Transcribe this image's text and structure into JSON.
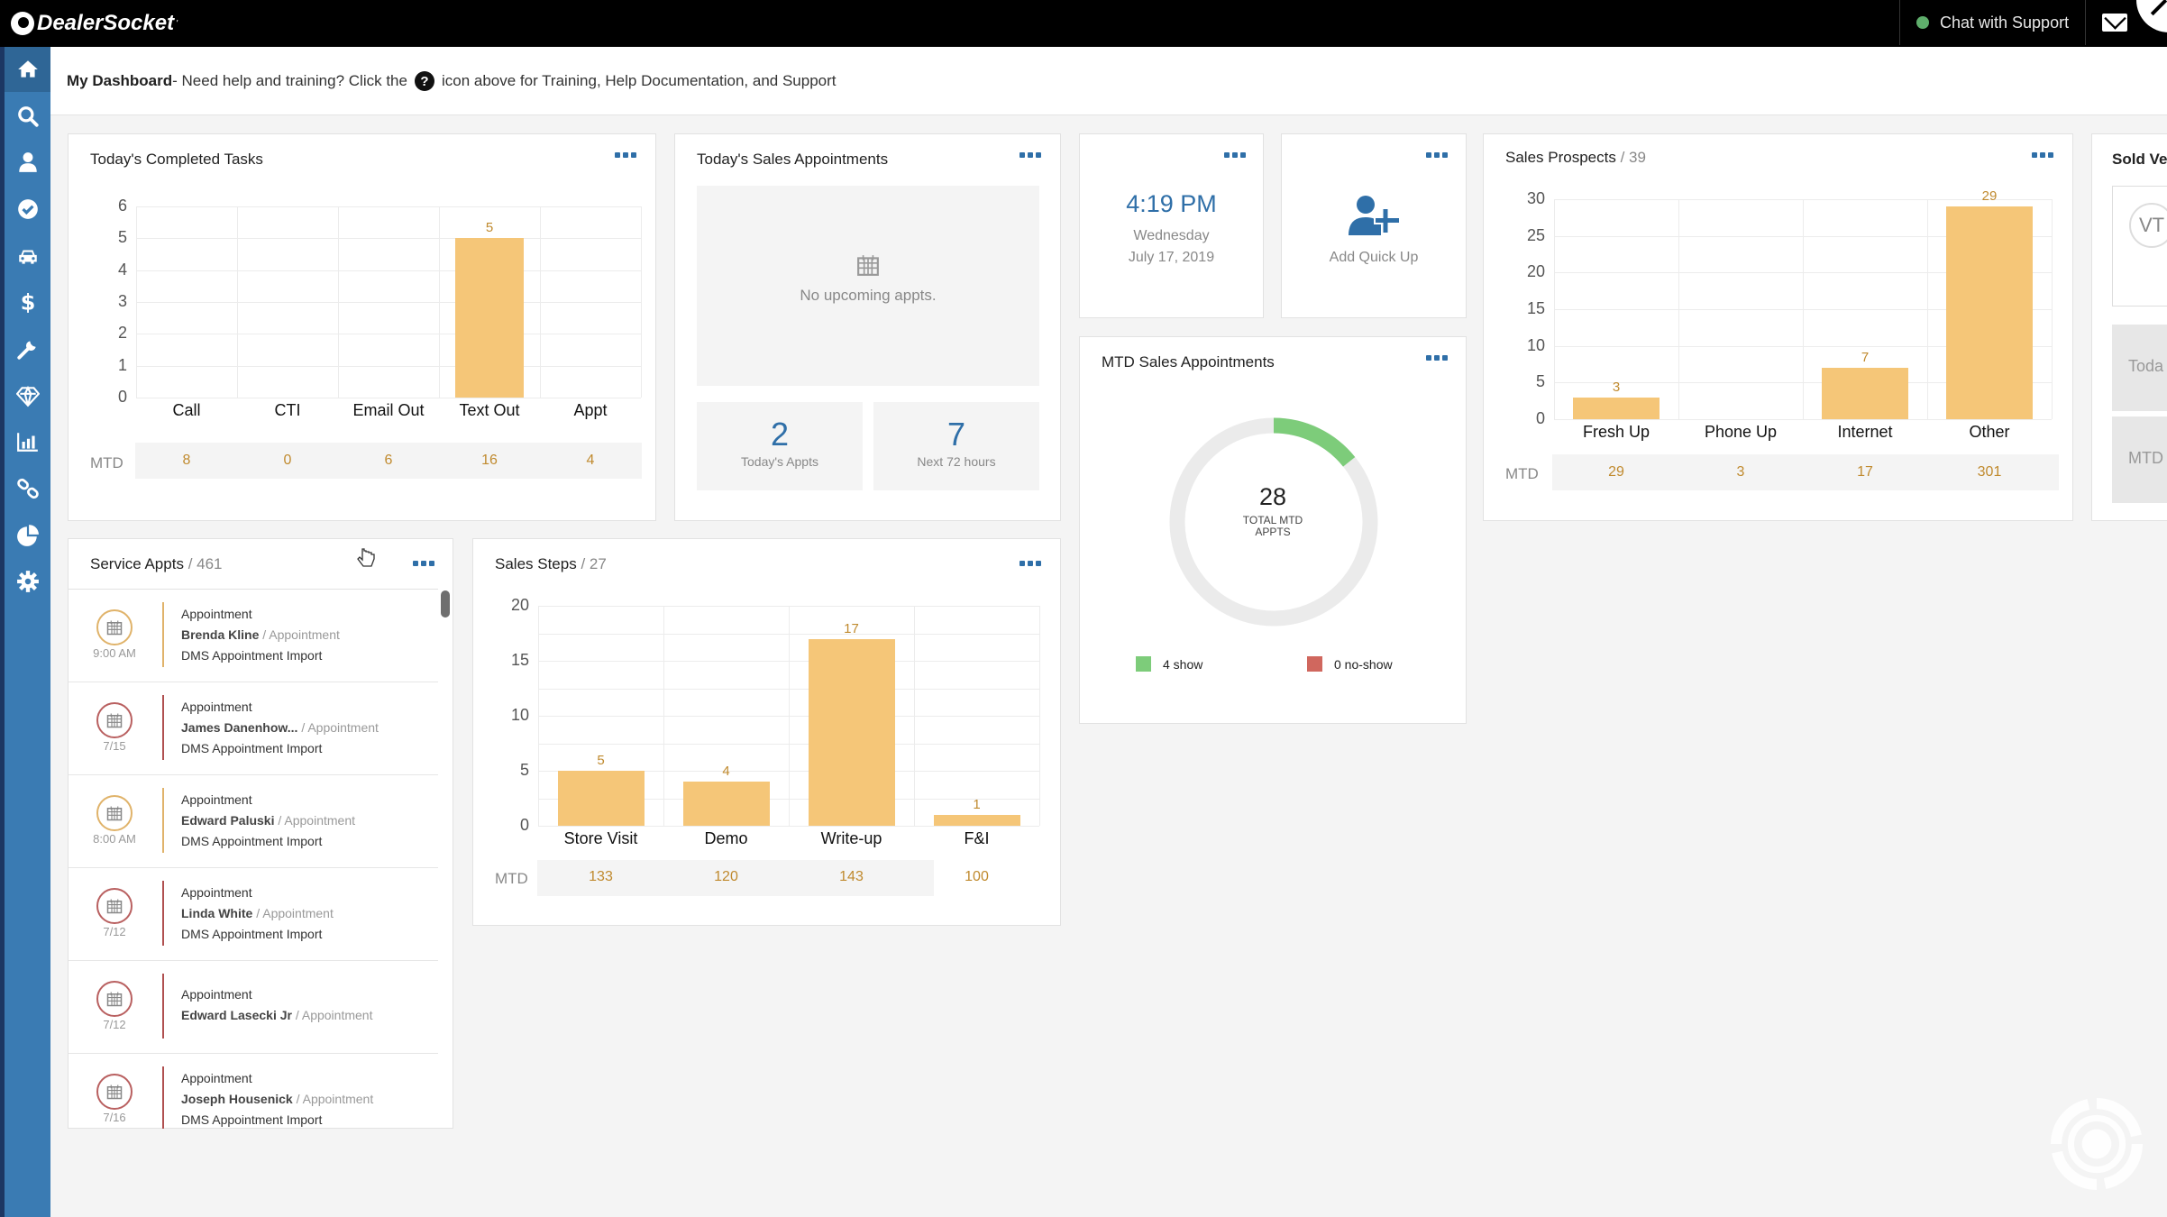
{
  "app": {
    "brand": "DealerSocket",
    "chat_label": "Chat with Support",
    "chat_status_color": "#5fae6c",
    "accent_color": "#2f6fa8",
    "bar_color": "#f5c678",
    "value_color": "#c08a2e"
  },
  "sidebar": {
    "items": [
      {
        "name": "home",
        "icon": "home-icon",
        "active": true
      },
      {
        "name": "search",
        "icon": "search-icon"
      },
      {
        "name": "contacts",
        "icon": "user-icon"
      },
      {
        "name": "tasks",
        "icon": "check-circle-icon"
      },
      {
        "name": "inventory",
        "icon": "car-icon"
      },
      {
        "name": "deals",
        "icon": "dollar-icon"
      },
      {
        "name": "service",
        "icon": "wrench-icon"
      },
      {
        "name": "loyalty",
        "icon": "diamond-icon"
      },
      {
        "name": "reports",
        "icon": "bar-chart-icon"
      },
      {
        "name": "links",
        "icon": "link-icon"
      },
      {
        "name": "analytics",
        "icon": "pie-chart-icon"
      },
      {
        "name": "settings",
        "icon": "gear-icon"
      }
    ]
  },
  "header": {
    "title": "My Dashboard",
    "help_before": " - Need help and training? Click the",
    "help_after": "icon above for Training, Help Documentation, and Support",
    "help_glyph": "?"
  },
  "completed_tasks": {
    "title": "Today's Completed Tasks",
    "mtd_label": "MTD",
    "mtd_values": [
      "8",
      "0",
      "6",
      "16",
      "4"
    ]
  },
  "sales_appointments": {
    "title": "Today's Sales Appointments",
    "empty_message": "No upcoming appts.",
    "today_count": "2",
    "today_label": "Today's Appts",
    "next_count": "7",
    "next_label": "Next 72 hours"
  },
  "clock": {
    "time": "4:19 PM",
    "day": "Wednesday",
    "date": "July 17, 2019"
  },
  "quick_up": {
    "label": "Add Quick Up"
  },
  "mtd_sales_appts": {
    "title": "MTD Sales Appointments",
    "total": "28",
    "total_label_1": "TOTAL MTD",
    "total_label_2": "APPTS",
    "show_label": "4 show",
    "noshow_label": "0 no-show",
    "show_color": "#7dcc7a",
    "noshow_color": "#d0675e",
    "track_color": "#ebebeb"
  },
  "sales_prospects": {
    "title": "Sales Prospects",
    "count": "/ 39",
    "mtd_label": "MTD",
    "mtd_values": [
      "29",
      "3",
      "17",
      "301"
    ]
  },
  "sold_vehicles": {
    "title": "Sold Ve",
    "avatar_initials": "VT",
    "today_label": "Toda",
    "mtd_label": "MTD"
  },
  "service_appts": {
    "title": "Service Appts",
    "count": "/ 461",
    "items": [
      {
        "time": "9:00 AM",
        "title": "Appointment",
        "name": "Brenda Kline",
        "type": "Appointment",
        "source": "DMS Appointment Import",
        "status": "upcoming"
      },
      {
        "time": "7/15",
        "title": "Appointment",
        "name": "James Danenhow...",
        "type": "Appointment",
        "source": "DMS Appointment Import",
        "status": "past"
      },
      {
        "time": "8:00 AM",
        "title": "Appointment",
        "name": "Edward Paluski",
        "type": "Appointment",
        "source": "DMS Appointment Import",
        "status": "upcoming"
      },
      {
        "time": "7/12",
        "title": "Appointment",
        "name": "Linda White",
        "type": "Appointment",
        "source": "DMS Appointment Import",
        "status": "past"
      },
      {
        "time": "7/12",
        "title": "Appointment",
        "name": "Edward Lasecki Jr",
        "type": "Appointment",
        "source": "",
        "status": "past"
      },
      {
        "time": "7/16",
        "title": "Appointment",
        "name": "Joseph Housenick",
        "type": "Appointment",
        "source": "DMS Appointment Import",
        "status": "past"
      }
    ]
  },
  "sales_steps": {
    "title": "Sales Steps",
    "count": "/ 27",
    "mtd_label": "MTD",
    "mtd_values": [
      "133",
      "120",
      "143",
      "100"
    ]
  },
  "chart_data": [
    {
      "id": "completed_tasks",
      "type": "bar",
      "title": "Today's Completed Tasks",
      "categories": [
        "Call",
        "CTI",
        "Email Out",
        "Text Out",
        "Appt"
      ],
      "values": [
        0,
        0,
        0,
        5,
        0
      ],
      "data_labels": [
        "",
        "",
        "",
        "5",
        ""
      ],
      "yticks": [
        "0",
        "1",
        "2",
        "3",
        "4",
        "5",
        "6"
      ],
      "ylim": [
        0,
        6
      ],
      "grid": true,
      "xlabel": "",
      "ylabel": ""
    },
    {
      "id": "sales_prospects",
      "type": "bar",
      "title": "Sales Prospects",
      "categories": [
        "Fresh Up",
        "Phone Up",
        "Internet",
        "Other"
      ],
      "values": [
        3,
        0,
        7,
        29
      ],
      "data_labels": [
        "3",
        "",
        "7",
        "29"
      ],
      "yticks": [
        "0",
        "5",
        "10",
        "15",
        "20",
        "25",
        "30"
      ],
      "ylim": [
        0,
        30
      ],
      "grid": true,
      "xlabel": "",
      "ylabel": ""
    },
    {
      "id": "sales_steps",
      "type": "bar",
      "title": "Sales Steps",
      "categories": [
        "Store Visit",
        "Demo",
        "Write-up",
        "F&I"
      ],
      "values": [
        5,
        4,
        17,
        1
      ],
      "data_labels": [
        "5",
        "4",
        "17",
        "1"
      ],
      "yticks": [
        "0",
        "5",
        "10",
        "15",
        "20"
      ],
      "ylim": [
        0,
        20
      ],
      "minor_gridlines": [
        2.5,
        7.5,
        12.5,
        17.5
      ],
      "grid": true,
      "xlabel": "",
      "ylabel": ""
    },
    {
      "id": "mtd_sales_appts",
      "type": "pie",
      "title": "MTD Sales Appointments",
      "total": 28,
      "slices": [
        {
          "label": "show",
          "value": 4
        },
        {
          "label": "no-show",
          "value": 0
        }
      ]
    }
  ]
}
